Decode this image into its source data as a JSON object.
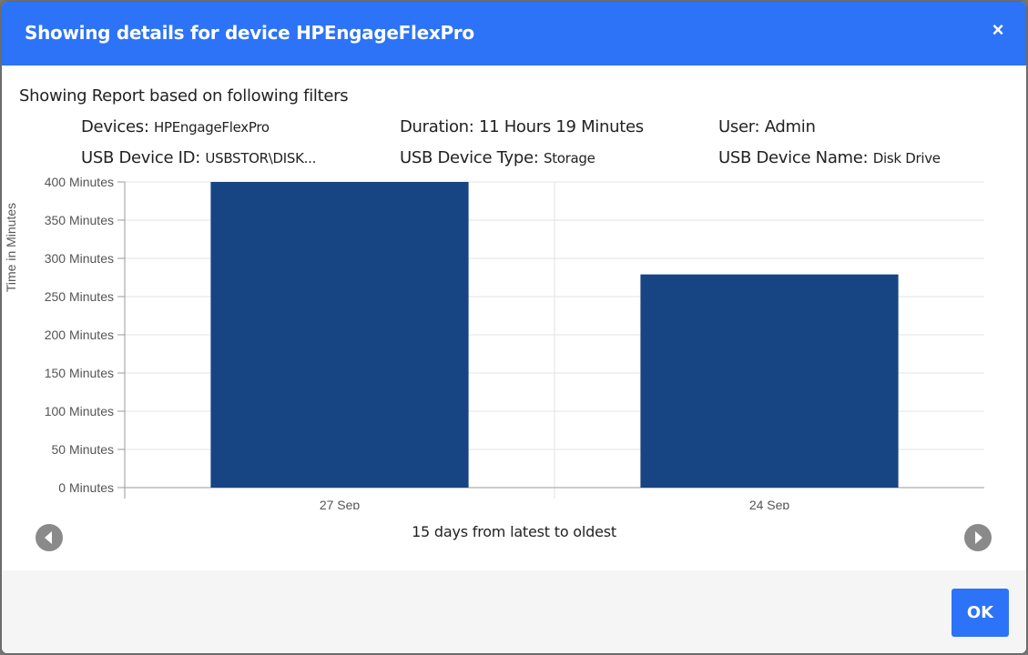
{
  "header": {
    "title": "Showing details for device HPEngageFlexPro",
    "close_label": "×"
  },
  "filters": {
    "heading": "Showing Report based on following filters",
    "devices_label": "Devices:",
    "devices_value": "HPEngageFlexPro",
    "duration_label": "Duration:",
    "duration_value": "11 Hours 19 Minutes",
    "user_label": "User:",
    "user_value": "Admin",
    "usb_id_label": "USB Device ID:",
    "usb_id_value": "USBSTOR\\DISK...",
    "usb_type_label": "USB Device Type:",
    "usb_type_value": "Storage",
    "usb_name_label": "USB Device Name:",
    "usb_name_value": "Disk Drive"
  },
  "chart_data": {
    "type": "bar",
    "categories": [
      "27 Sep",
      "24 Sep"
    ],
    "values": [
      400,
      279
    ],
    "ylabel": "Time in Minutes",
    "ylim": [
      0,
      400
    ],
    "yticks": [
      0,
      50,
      100,
      150,
      200,
      250,
      300,
      350,
      400
    ],
    "ytick_suffix": " Minutes",
    "bar_color": "#174584",
    "grid": true
  },
  "footer": {
    "caption": "15 days from latest to oldest",
    "ok_label": "OK"
  },
  "colors": {
    "accent": "#2c73f7",
    "bar": "#174584",
    "nav_button": "#8a8a8a"
  },
  "icons": {
    "prev": "chevron-left-icon",
    "next": "chevron-right-icon",
    "close": "close-icon"
  }
}
